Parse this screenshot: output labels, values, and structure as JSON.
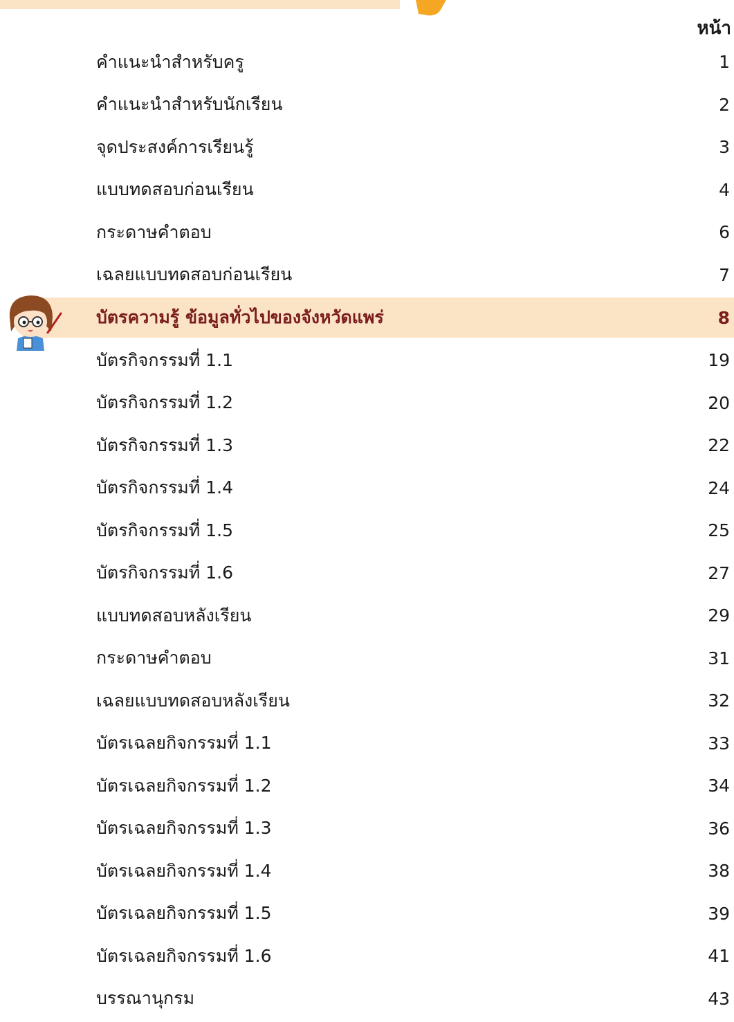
{
  "header": {
    "page_column_label": "หน้า"
  },
  "toc": [
    {
      "title": "คำแนะนำสำหรับครู",
      "page": "1"
    },
    {
      "title": "คำแนะนำสำหรับนักเรียน",
      "page": "2"
    },
    {
      "title": "จุดประสงค์การเรียนรู้",
      "page": "3"
    },
    {
      "title": "แบบทดสอบก่อนเรียน",
      "page": "4"
    },
    {
      "title": "กระดาษคำตอบ",
      "page": "6"
    },
    {
      "title": "เฉลยแบบทดสอบก่อนเรียน",
      "page": "7"
    },
    {
      "title": "บัตรความรู้ ข้อมูลทั่วไปของจังหวัดแพร่",
      "page": "8",
      "highlighted": true
    },
    {
      "title": "บัตรกิจกรรมที่ 1.1",
      "page": "19"
    },
    {
      "title": "บัตรกิจกรรมที่ 1.2",
      "page": "20"
    },
    {
      "title": "บัตรกิจกรรมที่ 1.3",
      "page": "22"
    },
    {
      "title": "บัตรกิจกรรมที่ 1.4",
      "page": "24"
    },
    {
      "title": "บัตรกิจกรรมที่ 1.5",
      "page": "25"
    },
    {
      "title": "บัตรกิจกรรมที่ 1.6",
      "page": "27"
    },
    {
      "title": "แบบทดสอบหลังเรียน",
      "page": "29"
    },
    {
      "title": "กระดาษคำตอบ",
      "page": "31"
    },
    {
      "title": "เฉลยแบบทดสอบหลังเรียน",
      "page": "32"
    },
    {
      "title": "บัตรเฉลยกิจกรรมที่ 1.1",
      "page": "33"
    },
    {
      "title": "บัตรเฉลยกิจกรรมที่ 1.2",
      "page": "34"
    },
    {
      "title": "บัตรเฉลยกิจกรรมที่ 1.3",
      "page": "36"
    },
    {
      "title": "บัตรเฉลยกิจกรรมที่ 1.4",
      "page": "38"
    },
    {
      "title": "บัตรเฉลยกิจกรรมที่ 1.5",
      "page": "39"
    },
    {
      "title": "บัตรเฉลยกิจกรรมที่ 1.6",
      "page": "41"
    },
    {
      "title": "บรรณานุกรม",
      "page": "43"
    }
  ],
  "colors": {
    "highlight_background": "#fbe3c6",
    "highlight_text": "#7a1d1d",
    "accent_orange": "#f5a623"
  },
  "decorations": {
    "mascot_icon": "girl-teacher-cartoon-icon"
  }
}
